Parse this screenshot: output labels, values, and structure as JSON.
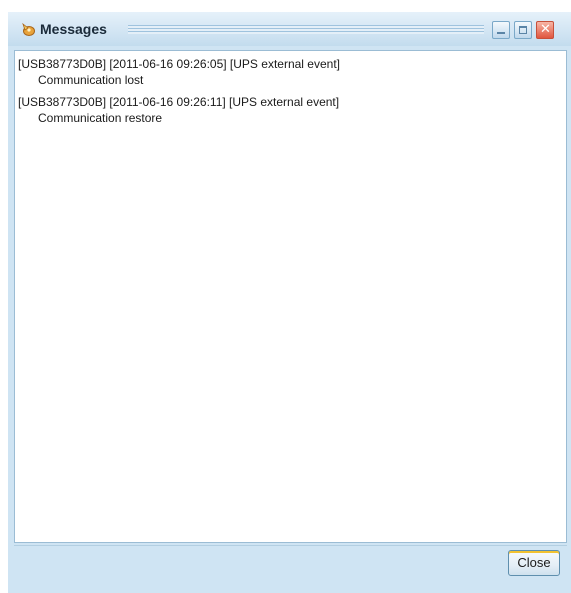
{
  "window": {
    "title": "Messages",
    "icon": "messages-app-icon",
    "controls": {
      "minimize_icon": "minimize-icon",
      "maximize_icon": "maximize-icon",
      "close_icon": "close-icon",
      "close_glyph": "✕"
    }
  },
  "messages": [
    {
      "header": "[USB38773D0B] [2011-06-16 09:26:05] [UPS external event]",
      "body": "Communication lost"
    },
    {
      "header": "[USB38773D0B] [2011-06-16 09:26:11] [UPS external event]",
      "body": "Communication restore"
    }
  ],
  "footer": {
    "close_label": "Close"
  },
  "colors": {
    "window_background": "#cfe4f3",
    "titlebar_close_button": "#e0563f",
    "button_focus_accent": "#f2c230"
  }
}
